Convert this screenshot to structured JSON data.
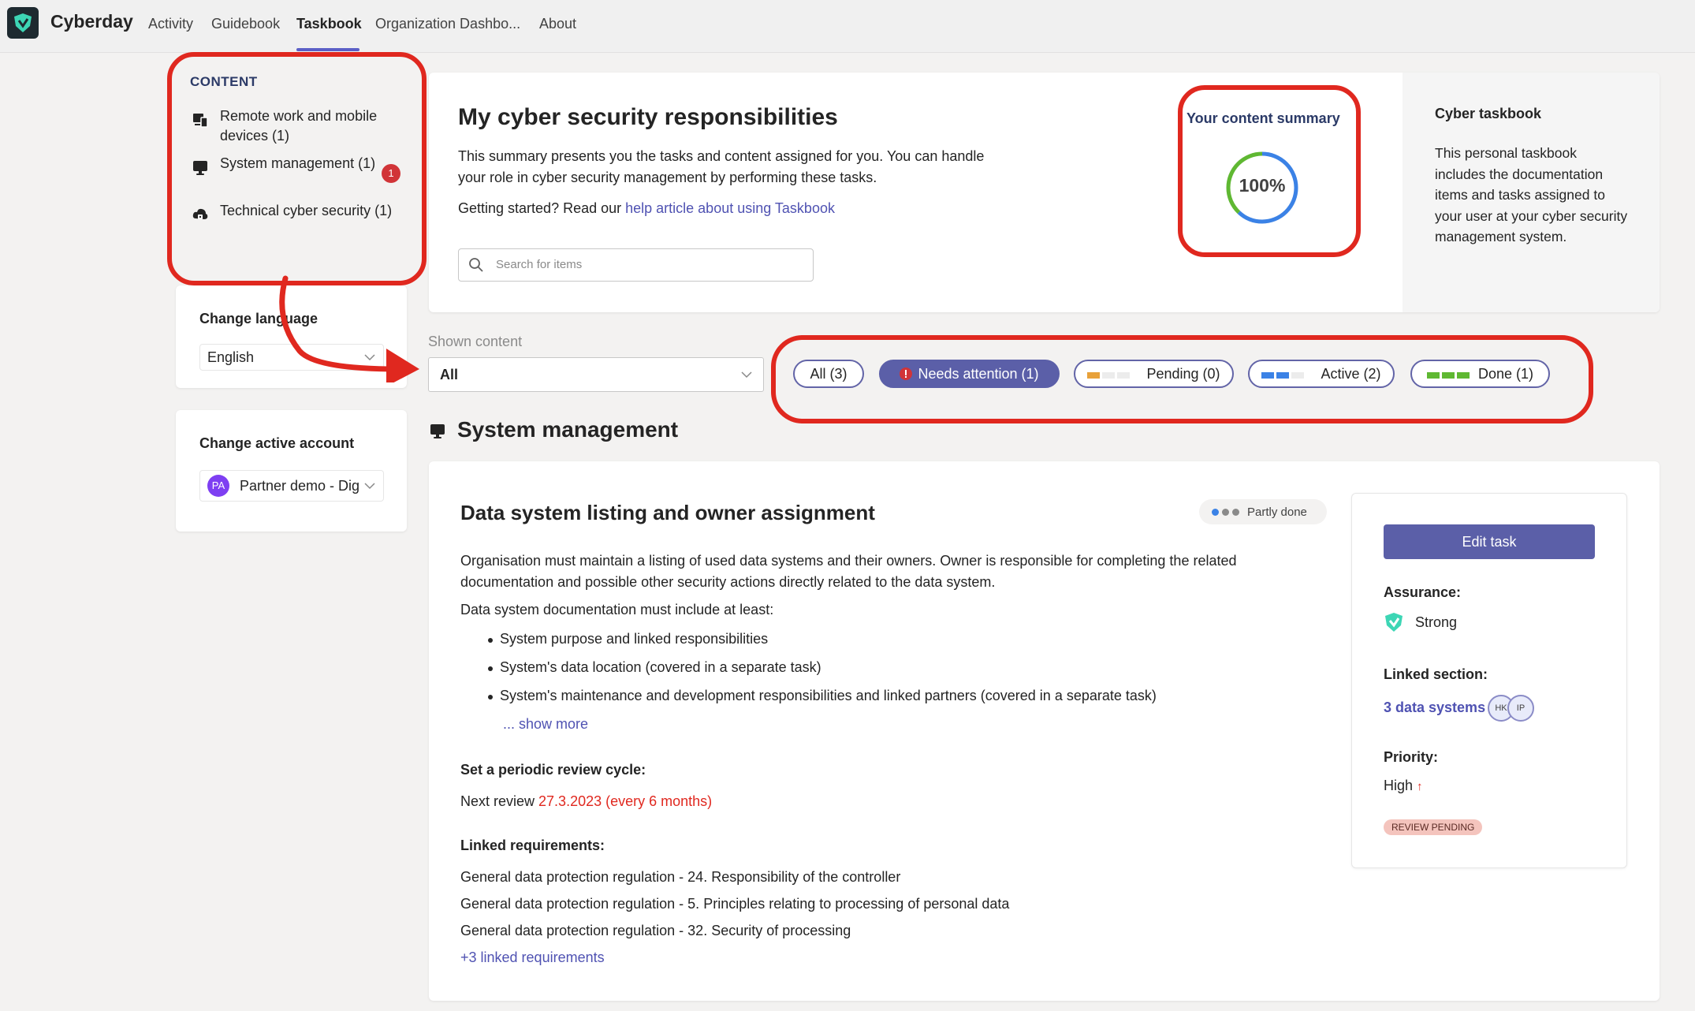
{
  "app": {
    "name": "Cyberday",
    "nav": [
      "Activity",
      "Guidebook",
      "Taskbook",
      "Organization Dashbo...",
      "About"
    ],
    "active_nav": "Taskbook"
  },
  "sidebar": {
    "content_heading": "CONTENT",
    "content_items": [
      {
        "label": "Remote work and mobile devices (1)",
        "icon": "devices-icon"
      },
      {
        "label": "System management (1)",
        "icon": "monitor-icon",
        "badge": "1"
      },
      {
        "label": "Technical cyber security (1)",
        "icon": "cloud-lock-icon"
      }
    ],
    "language": {
      "title": "Change language",
      "value": "English"
    },
    "account": {
      "title": "Change active account",
      "avatar_initials": "PA",
      "value": "Partner demo - Dig"
    }
  },
  "header": {
    "title": "My cyber security responsibilities",
    "description": "This summary presents you the tasks and content assigned for you. You can handle your role in cyber security management by performing these tasks.",
    "getting_started": "Getting started? Read our ",
    "help_link": "help article about using Taskbook",
    "search_placeholder": "Search for items",
    "summary_label": "Your content summary",
    "summary_percent": "100%",
    "summary_value": 1.0
  },
  "info_panel": {
    "title": "Cyber taskbook",
    "text": "This personal taskbook includes the documentation items and tasks assigned to your user at your cyber security management system."
  },
  "filters": {
    "shown_content_label": "Shown content",
    "shown_content_value": "All",
    "pills": [
      {
        "label": "All (3)",
        "selected": false
      },
      {
        "label": "Needs attention (1)",
        "selected": true
      },
      {
        "label": "Pending (0)",
        "selected": false
      },
      {
        "label": "Active (2)",
        "selected": false
      },
      {
        "label": "Done (1)",
        "selected": false
      }
    ]
  },
  "section": {
    "title": "System management"
  },
  "task": {
    "title": "Data system listing and owner assignment",
    "status": "Partly done",
    "description": "Organisation must maintain a listing of used data systems and their owners. Owner is responsible for completing the related documentation and possible other security actions directly related to the data system.",
    "list_intro": "Data system documentation must include at least:",
    "bullets": [
      "System purpose and linked responsibilities",
      "System's data location (covered in a separate task)",
      "System's maintenance and development responsibilities and linked partners (covered in a separate task)"
    ],
    "show_more": "... show more",
    "review_heading": "Set a periodic review cycle:",
    "review_prefix": "Next review ",
    "review_value": "27.3.2023 (every 6 months)",
    "requirements_heading": "Linked requirements:",
    "requirements": [
      "General data protection regulation - 24. Responsibility of the controller",
      "General data protection regulation - 5. Principles relating to processing of personal data",
      "General data protection regulation - 32. Security of processing"
    ],
    "more_requirements": "+3 linked requirements"
  },
  "task_panel": {
    "edit_button": "Edit task",
    "assurance_label": "Assurance:",
    "assurance_value": "Strong",
    "linked_section_label": "Linked section:",
    "linked_section_value": "3 data systems",
    "linked_avatars": [
      "HK",
      "IP"
    ],
    "priority_label": "Priority:",
    "priority_value": "High",
    "priority_icon": "↑",
    "review_badge": "REVIEW PENDING"
  },
  "colors": {
    "accent": "#5b5fa8",
    "annotation_red": "#e0281f",
    "danger": "#d13438",
    "pending": "#e8a13a",
    "active": "#3b82e6",
    "done": "#5fb832"
  }
}
